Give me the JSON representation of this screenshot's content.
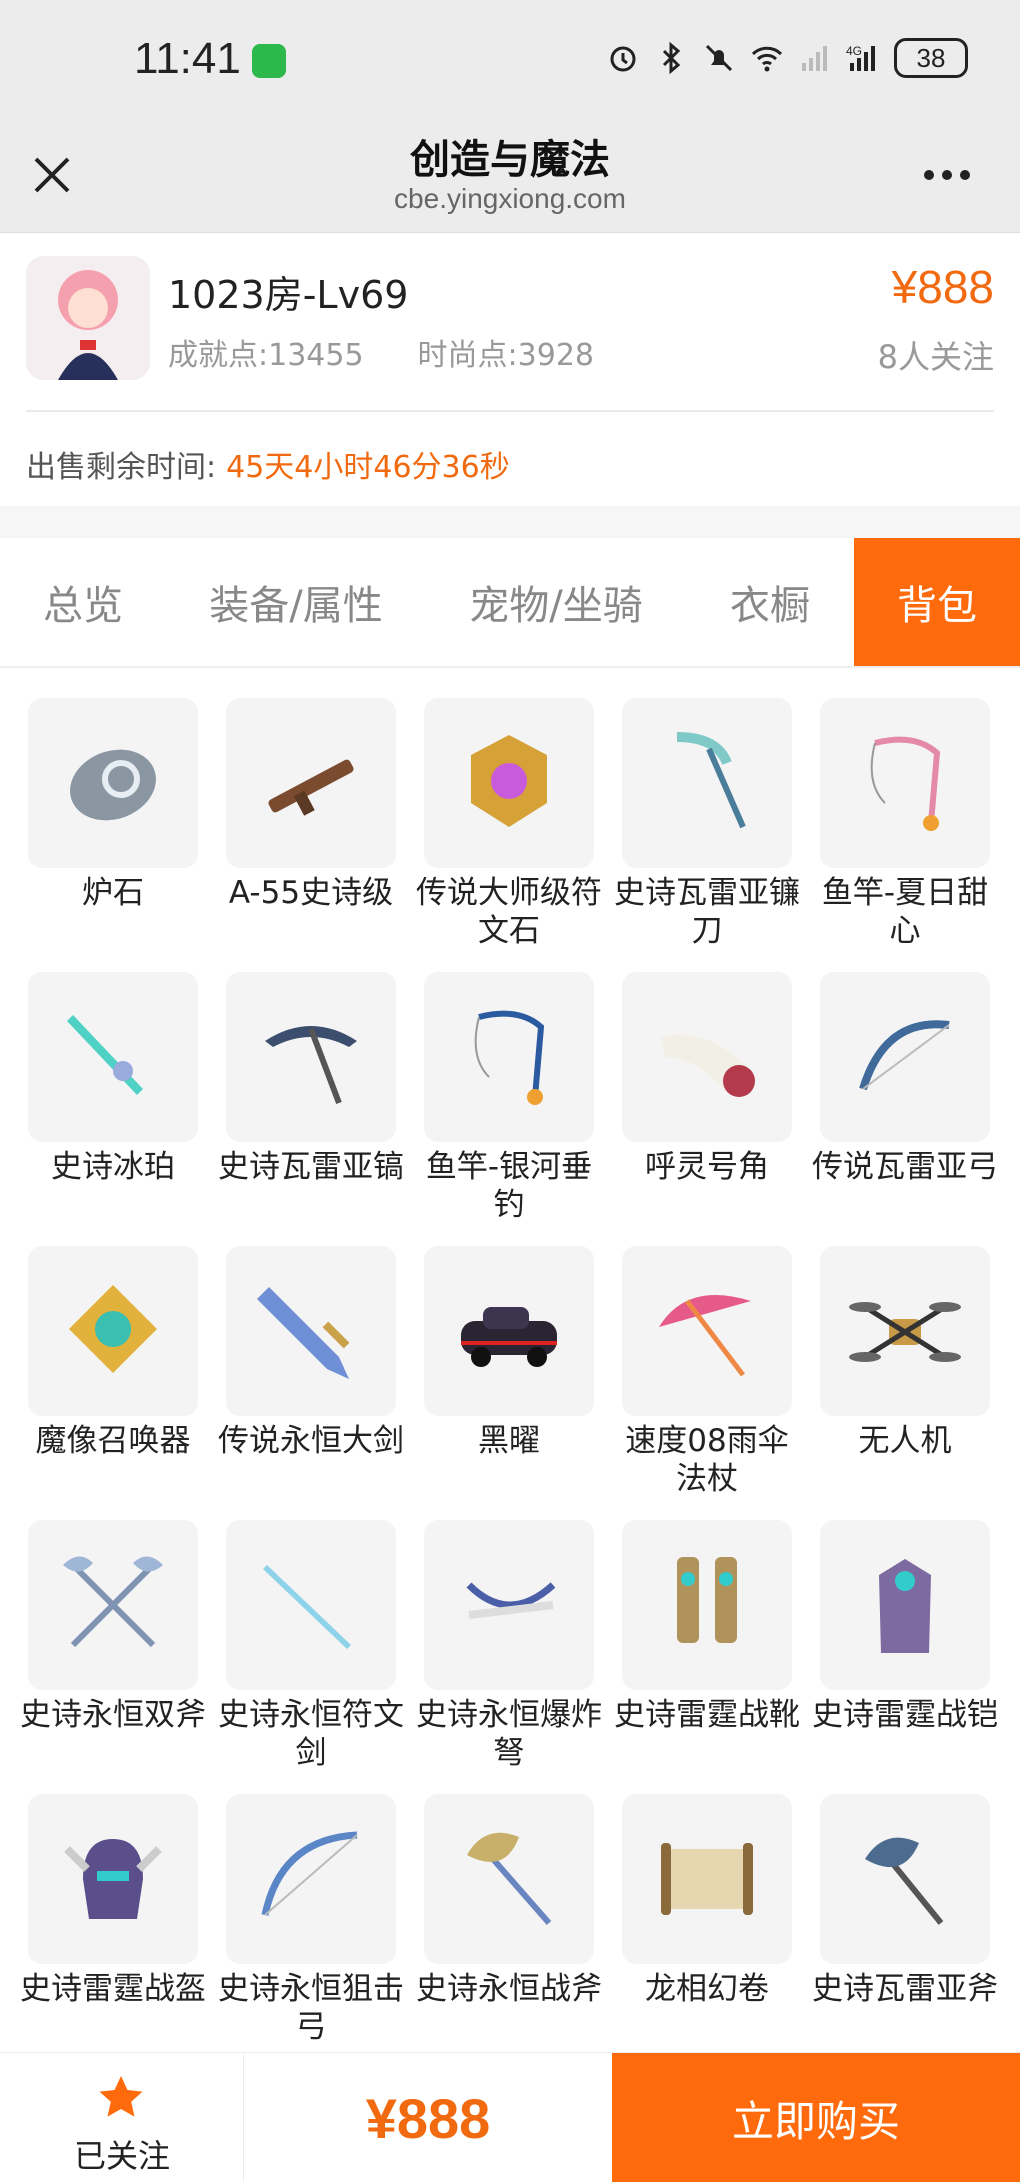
{
  "status_bar": {
    "time": "11:41",
    "battery": "38",
    "network": "4G"
  },
  "titlebar": {
    "title": "创造与魔法",
    "subtitle": "cbe.yingxiong.com"
  },
  "product": {
    "name": "1023房-Lv69",
    "achievement": "成就点:13455",
    "fashion": "时尚点:3928",
    "price": "¥888",
    "followers": "8人关注",
    "timer_label": "出售剩余时间:",
    "timer_value": "45天4小时46分36秒"
  },
  "tabs": [
    {
      "label": "总览",
      "active": false
    },
    {
      "label": "装备/属性",
      "active": false
    },
    {
      "label": "宠物/坐骑",
      "active": false
    },
    {
      "label": "衣橱",
      "active": false
    },
    {
      "label": "背包",
      "active": true
    }
  ],
  "items": [
    {
      "label": "炉石",
      "icon": "stone-icon",
      "color": "#8a97a3"
    },
    {
      "label": "A-55史诗级",
      "icon": "rifle-icon",
      "color": "#7a4b2e"
    },
    {
      "label": "传说大师级符文石",
      "icon": "rune-stone-icon",
      "color": "#d6a238"
    },
    {
      "label": "史诗瓦雷亚镰刀",
      "icon": "scythe-icon",
      "color": "#7fc9c8"
    },
    {
      "label": "鱼竿-夏日甜心",
      "icon": "fishing-rod-icon",
      "color": "#e48aa8"
    },
    {
      "label": "史诗冰珀",
      "icon": "ice-sword-icon",
      "color": "#4fd1c5"
    },
    {
      "label": "史诗瓦雷亚镐",
      "icon": "pickaxe-icon",
      "color": "#3c4e6e"
    },
    {
      "label": "鱼竿-银河垂钓",
      "icon": "fishing-rod-icon",
      "color": "#2c5aa0"
    },
    {
      "label": "呼灵号角",
      "icon": "horn-icon",
      "color": "#b23a4a"
    },
    {
      "label": "传说瓦雷亚弓",
      "icon": "bow-icon",
      "color": "#3f6a9a"
    },
    {
      "label": "魔像召唤器",
      "icon": "summoner-icon",
      "color": "#e0b23c"
    },
    {
      "label": "传说永恒大剑",
      "icon": "greatsword-icon",
      "color": "#6f8fd6"
    },
    {
      "label": "黑曜",
      "icon": "car-icon",
      "color": "#2b2433"
    },
    {
      "label": "速度08雨伞法杖",
      "icon": "umbrella-icon",
      "color": "#e65a8a"
    },
    {
      "label": "无人机",
      "icon": "drone-icon",
      "color": "#c99a48"
    },
    {
      "label": "史诗永恒双斧",
      "icon": "double-axe-icon",
      "color": "#7f93b3"
    },
    {
      "label": "史诗永恒符文剑",
      "icon": "rune-sword-icon",
      "color": "#8fd3ea"
    },
    {
      "label": "史诗永恒爆炸弩",
      "icon": "crossbow-icon",
      "color": "#4a5fa8"
    },
    {
      "label": "史诗雷霆战靴",
      "icon": "boots-icon",
      "color": "#b0935a"
    },
    {
      "label": "史诗雷霆战铠",
      "icon": "armor-icon",
      "color": "#7d6aa0"
    },
    {
      "label": "史诗雷霆战盔",
      "icon": "helmet-icon",
      "color": "#5a4f8a"
    },
    {
      "label": "史诗永恒狙击弓",
      "icon": "sniper-bow-icon",
      "color": "#5a86c8"
    },
    {
      "label": "史诗永恒战斧",
      "icon": "battle-axe-icon",
      "color": "#c8b06a"
    },
    {
      "label": "龙相幻卷",
      "icon": "scroll-icon",
      "color": "#8a6a3a"
    },
    {
      "label": "史诗瓦雷亚斧",
      "icon": "axe-icon",
      "color": "#4d6a8f"
    }
  ],
  "bottom": {
    "follow_label": "已关注",
    "price": "¥888",
    "buy_label": "立即购买"
  },
  "colors": {
    "accent": "#ff6a0c",
    "price": "#f26a10"
  }
}
